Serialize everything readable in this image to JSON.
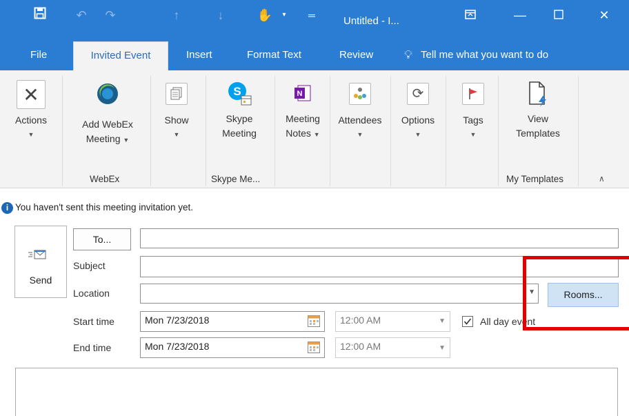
{
  "window": {
    "title": "Untitled - I..."
  },
  "quick_access": {
    "save_icon": "save-icon",
    "undo_icon": "undo-icon",
    "redo_icon": "redo-icon",
    "up_icon": "arrow-up-icon",
    "down_icon": "arrow-down-icon",
    "touch_icon": "touch-mode-icon",
    "customize_icon": "customize-icon"
  },
  "window_controls": {
    "restore_ribbon": "ribbon-display-icon",
    "minimize": "minimize-icon",
    "maximize": "maximize-icon",
    "close": "close-icon"
  },
  "tabs": [
    {
      "label": "File"
    },
    {
      "label": "Invited Event"
    },
    {
      "label": "Insert"
    },
    {
      "label": "Format Text"
    },
    {
      "label": "Review"
    },
    {
      "label": "Tell me what you want to do"
    }
  ],
  "ribbon": {
    "actions": {
      "label": "Actions"
    },
    "webex": {
      "label_line1": "Add WebEx",
      "label_line2": "Meeting",
      "group": "WebEx"
    },
    "show": {
      "label": "Show"
    },
    "skype": {
      "label_line1": "Skype",
      "label_line2": "Meeting",
      "group": "Skype Me..."
    },
    "onenote": {
      "label_line1": "Meeting",
      "label_line2": "Notes"
    },
    "attendees": {
      "label": "Attendees"
    },
    "options": {
      "label": "Options"
    },
    "tags": {
      "label": "Tags"
    },
    "templates": {
      "label_line1": "View",
      "label_line2": "Templates",
      "group": "My Templates"
    }
  },
  "info_bar": {
    "text": "You haven't sent this meeting invitation yet."
  },
  "form": {
    "send_label": "Send",
    "to_button": "To...",
    "to_value": "",
    "subject_label": "Subject",
    "subject_value": "",
    "location_label": "Location",
    "location_value": "",
    "rooms_button": "Rooms...",
    "start_label": "Start time",
    "start_date": "Mon 7/23/2018",
    "start_time": "12:00 AM",
    "end_label": "End time",
    "end_date": "Mon 7/23/2018",
    "end_time": "12:00 AM",
    "all_day_label": "All day event",
    "all_day_checked": true
  },
  "colors": {
    "accent": "#2b7cd3",
    "highlight_box": "#e00000",
    "rooms_bg": "#cfe3f5"
  }
}
